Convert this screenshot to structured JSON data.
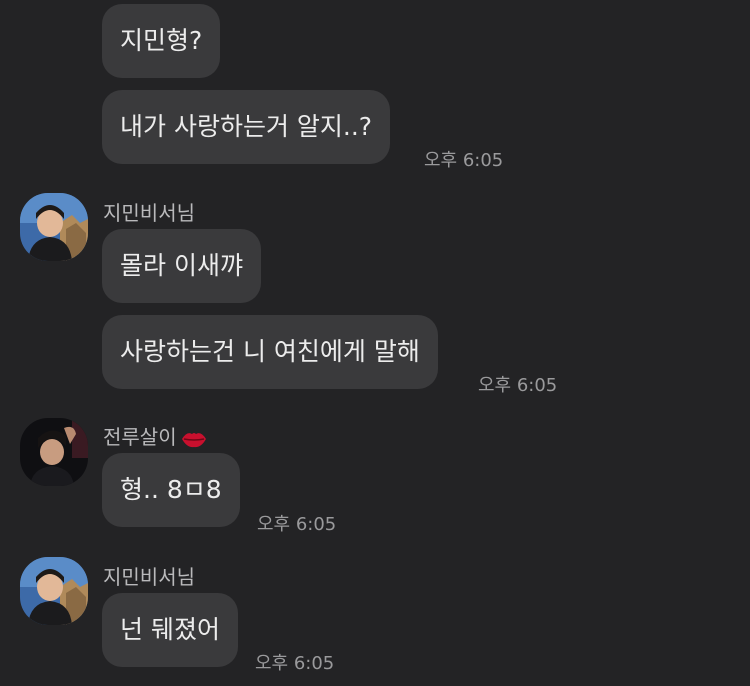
{
  "messages": [
    {
      "text": "지민형?"
    },
    {
      "text": "내가 사랑하는거 알지..?",
      "time": "오후 6:05"
    },
    {
      "sender": "지민비서님",
      "text": "몰라 이새꺄"
    },
    {
      "text": "사랑하는건 니 여친에게 말해",
      "time": "오후 6:05"
    },
    {
      "sender": "전루살이",
      "sender_icon": "lips-icon",
      "text": "형.. 8ㅁ8",
      "time": "오후 6:05"
    },
    {
      "sender": "지민비서님",
      "text": "넌 뒈졌어",
      "time": "오후 6:05"
    }
  ],
  "colors": {
    "background": "#232325",
    "bubble": "#3a3a3c",
    "text": "#ececec",
    "timestamp": "#9a9a9c",
    "sender": "#b9b9bb",
    "lips": "#c8102e"
  }
}
